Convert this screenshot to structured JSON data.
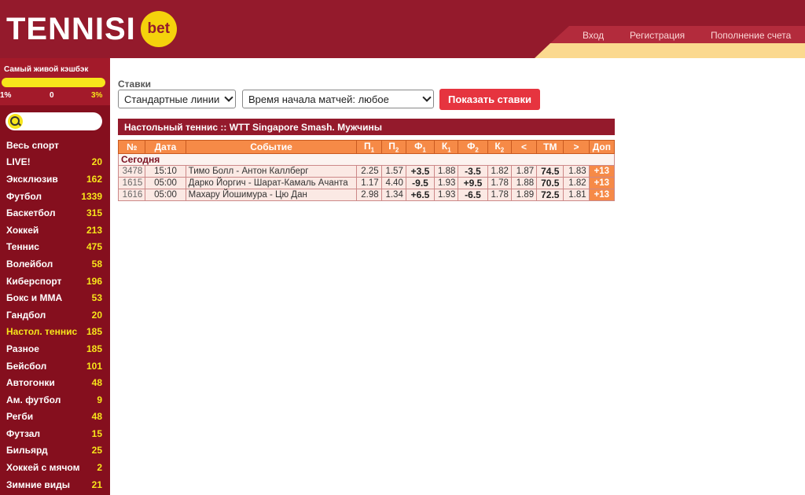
{
  "header": {
    "logo_text": "TENNISI",
    "logo_badge": "bet",
    "nav": [
      {
        "label": "Вход"
      },
      {
        "label": "Регистрация"
      },
      {
        "label": "Пополнение счета"
      }
    ]
  },
  "sidebar": {
    "cashback": {
      "title": "Самый живой кэшбэк",
      "min": "1%",
      "mid": "0",
      "max": "3%"
    },
    "search_placeholder": "",
    "items": [
      {
        "name": "Весь спорт",
        "count": ""
      },
      {
        "name": "LIVE!",
        "count": "20"
      },
      {
        "name": "Эксклюзив",
        "count": "162"
      },
      {
        "name": "Футбол",
        "count": "1339"
      },
      {
        "name": "Баскетбол",
        "count": "315"
      },
      {
        "name": "Хоккей",
        "count": "213"
      },
      {
        "name": "Теннис",
        "count": "475"
      },
      {
        "name": "Волейбол",
        "count": "58"
      },
      {
        "name": "Киберспорт",
        "count": "196"
      },
      {
        "name": "Бокс и ММА",
        "count": "53"
      },
      {
        "name": "Гандбол",
        "count": "20"
      },
      {
        "name": "Настол. теннис",
        "count": "185",
        "active": true
      },
      {
        "name": "Разное",
        "count": "185"
      },
      {
        "name": "Бейсбол",
        "count": "101"
      },
      {
        "name": "Автогонки",
        "count": "48"
      },
      {
        "name": "Ам. футбол",
        "count": "9"
      },
      {
        "name": "Регби",
        "count": "48"
      },
      {
        "name": "Футзал",
        "count": "15"
      },
      {
        "name": "Бильярд",
        "count": "25"
      },
      {
        "name": "Хоккей с мячом",
        "count": "2"
      },
      {
        "name": "Зимние виды",
        "count": "21"
      }
    ]
  },
  "main": {
    "bets_label": "Ставки",
    "line_select": "Стандартные линии",
    "time_select": "Время начала матчей: любое",
    "show_button": "Показать ставки",
    "league_title": "Настольный теннис :: WTT Singapore Smash. Мужчины",
    "columns": [
      "№",
      "Дата",
      "Событие",
      "П1",
      "П2",
      "Ф1",
      "К1",
      "Ф2",
      "К2",
      "<",
      "ТМ",
      ">",
      "Доп"
    ],
    "day_label": "Сегодня",
    "rows": [
      {
        "id": "3478",
        "time": "15:10",
        "event": "Тимо Болл - Антон Каллберг",
        "p1": "2.25",
        "p2": "1.57",
        "f1": "+3.5",
        "k1": "1.88",
        "f2": "-3.5",
        "k2": "1.82",
        "under": "1.87",
        "tm": "74.5",
        "over": "1.83",
        "dop": "+13"
      },
      {
        "id": "1615",
        "time": "05:00",
        "event": "Дарко Йоргич - Шарат-Камаль Ачанта",
        "p1": "1.17",
        "p2": "4.40",
        "f1": "-9.5",
        "k1": "1.93",
        "f2": "+9.5",
        "k2": "1.78",
        "under": "1.88",
        "tm": "70.5",
        "over": "1.82",
        "dop": "+13"
      },
      {
        "id": "1616",
        "time": "05:00",
        "event": "Махару Йошимура - Цю Дан",
        "p1": "2.98",
        "p2": "1.34",
        "f1": "+6.5",
        "k1": "1.93",
        "f2": "-6.5",
        "k2": "1.78",
        "under": "1.89",
        "tm": "72.5",
        "over": "1.81",
        "dop": "+13"
      }
    ]
  }
}
